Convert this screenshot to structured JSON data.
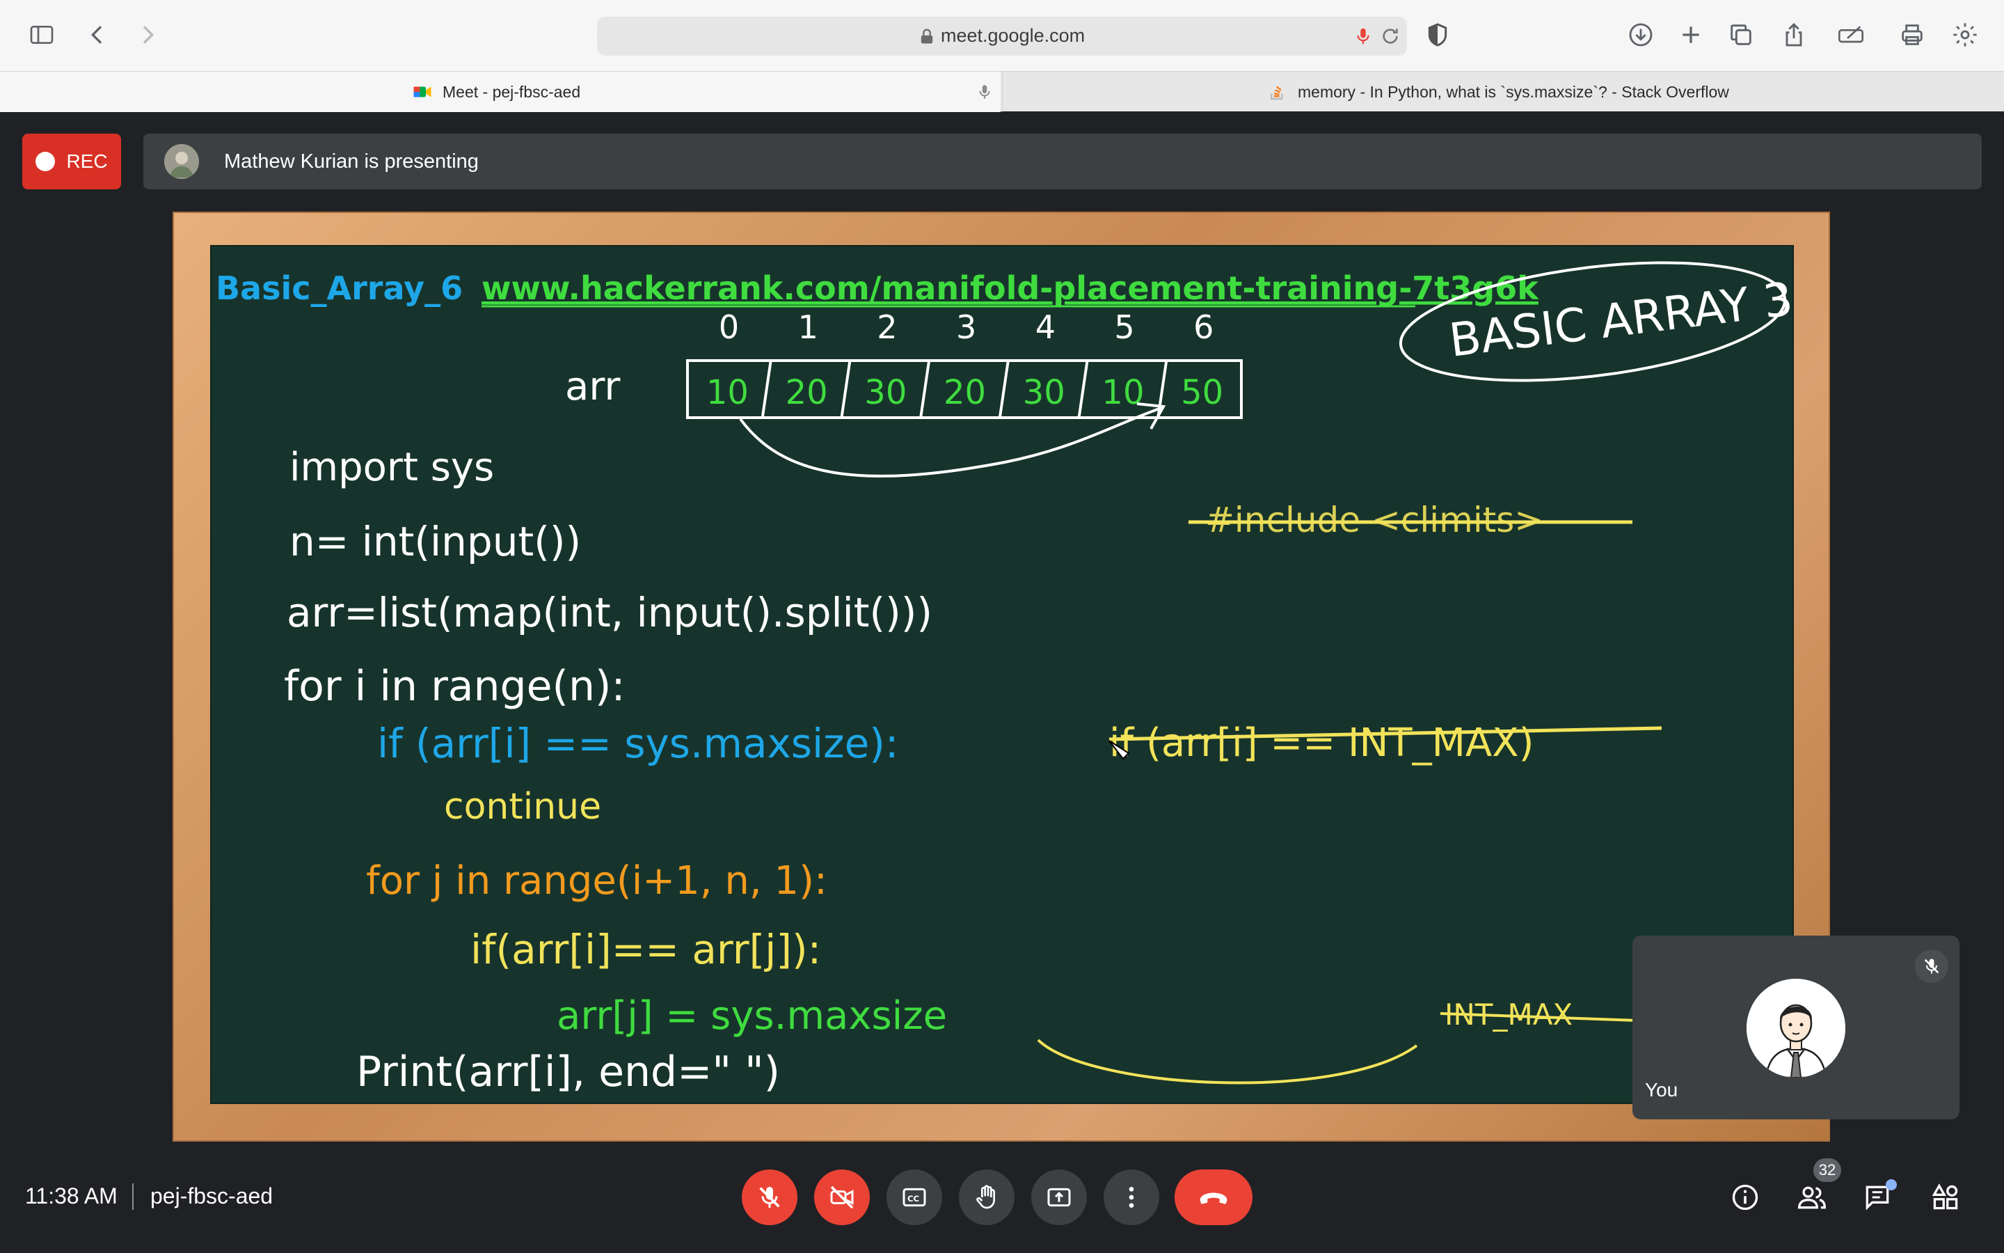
{
  "browser": {
    "url": "meet.google.com",
    "tabs": [
      {
        "title": "Meet - pej-fbsc-aed",
        "active": true,
        "favicon": "meet-icon"
      },
      {
        "title": "memory - In Python, what is `sys.maxsize`? - Stack Overflow",
        "active": false,
        "favicon": "stackoverflow-icon"
      }
    ]
  },
  "meeting": {
    "rec_label": "REC",
    "presenting_text": "Mathew Kurian is presenting",
    "time": "11:38 AM",
    "code": "pej-fbsc-aed",
    "self_label": "You",
    "participants_count": "32"
  },
  "slide": {
    "heading": "Basic_Array_6",
    "link": "www.hackerrank.com/manifold-placement-training-7t3g6k",
    "bubble_text": "BASIC ARRAY 3",
    "arr_label": "arr",
    "indices": [
      "0",
      "1",
      "2",
      "3",
      "4",
      "5",
      "6"
    ],
    "values": [
      "10",
      "20",
      "30",
      "20",
      "30",
      "10",
      "50"
    ],
    "code_lines": [
      {
        "text": "import sys",
        "color": "#ffffff"
      },
      {
        "text": "n= int(input())",
        "color": "#ffffff"
      },
      {
        "text": "arr=list(map(int, input().split()))",
        "color": "#ffffff"
      },
      {
        "text": "for  i in range(n):",
        "color": "#ffffff"
      },
      {
        "text": "if (arr[i] == sys.maxsize):",
        "color": "#1ea7e8"
      },
      {
        "text": "continue",
        "color": "#f2e35a"
      },
      {
        "text": "for  j  in range(i+1, n, 1):",
        "color": "#f39a1e"
      },
      {
        "text": "if(arr[i]== arr[j]):",
        "color": "#f2e35a"
      },
      {
        "text": "arr[j] = sys.maxsize",
        "color": "#3fdc3f"
      },
      {
        "text": "Print(arr[i], end=\"  \")",
        "color": "#ffffff"
      }
    ],
    "side_notes": [
      {
        "text": "#include <climits>",
        "color": "#f2e35a"
      },
      {
        "text": "if (arr[i] == INT_MAX)",
        "color": "#f2e35a"
      },
      {
        "text": "INT_MAX",
        "color": "#f2e35a"
      }
    ]
  },
  "colors": {
    "rec": "#d93025",
    "end_call": "#ea4335",
    "board": "#17342c",
    "heading": "#1ea7e8",
    "link": "#3fdc3f"
  }
}
